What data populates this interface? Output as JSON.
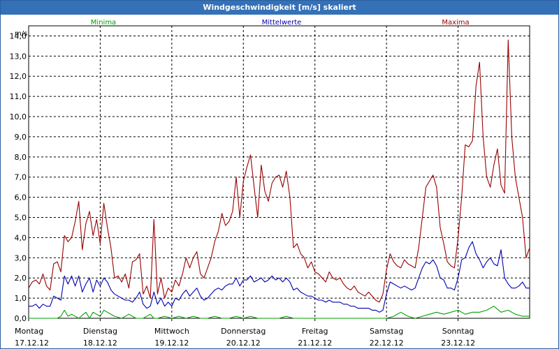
{
  "window": {
    "title": "Windgeschwindigkeit [m/s] skaliert"
  },
  "legend": {
    "minima": "Minima",
    "mittelwerte": "Mittelwerte",
    "maxima": "Maxima"
  },
  "colors": {
    "minima": "#00a000",
    "mittelwerte": "#0000b0",
    "maxima": "#990000",
    "titlebar": "#3471b7"
  },
  "chart_data": {
    "type": "line",
    "ylabel": "m/s",
    "ylim": [
      0,
      14.5
    ],
    "yticks": [
      "0,0",
      "1,0",
      "2,0",
      "3,0",
      "4,0",
      "5,0",
      "6,0",
      "7,0",
      "8,0",
      "9,0",
      "10,0",
      "11,0",
      "12,0",
      "13,0",
      "14,0"
    ],
    "xlim": [
      0,
      7
    ],
    "days": [
      {
        "weekday": "Montag",
        "date": "17.12.12"
      },
      {
        "weekday": "Dienstag",
        "date": "18.12.12"
      },
      {
        "weekday": "Mittwoch",
        "date": "19.12.12"
      },
      {
        "weekday": "Donnerstag",
        "date": "20.12.12"
      },
      {
        "weekday": "Freitag",
        "date": "21.12.12"
      },
      {
        "weekday": "Samstag",
        "date": "22.12.12"
      },
      {
        "weekday": "Sonntag",
        "date": "23.12.12"
      }
    ],
    "grid": true,
    "series": [
      {
        "name": "Maxima",
        "color": "#990000",
        "x": [
          0.0,
          0.05,
          0.1,
          0.15,
          0.2,
          0.25,
          0.3,
          0.35,
          0.4,
          0.45,
          0.5,
          0.55,
          0.6,
          0.65,
          0.7,
          0.75,
          0.8,
          0.85,
          0.9,
          0.95,
          1.0,
          1.05,
          1.1,
          1.15,
          1.2,
          1.25,
          1.3,
          1.35,
          1.4,
          1.45,
          1.5,
          1.55,
          1.6,
          1.65,
          1.7,
          1.75,
          1.8,
          1.85,
          1.9,
          1.95,
          2.0,
          2.05,
          2.1,
          2.15,
          2.2,
          2.25,
          2.3,
          2.35,
          2.4,
          2.45,
          2.5,
          2.55,
          2.6,
          2.65,
          2.7,
          2.75,
          2.8,
          2.85,
          2.9,
          2.95,
          3.0,
          3.05,
          3.1,
          3.15,
          3.2,
          3.25,
          3.3,
          3.35,
          3.4,
          3.45,
          3.5,
          3.55,
          3.6,
          3.65,
          3.7,
          3.75,
          3.8,
          3.85,
          3.9,
          3.95,
          4.0,
          4.05,
          4.1,
          4.15,
          4.2,
          4.25,
          4.3,
          4.35,
          4.4,
          4.45,
          4.5,
          4.55,
          4.6,
          4.65,
          4.7,
          4.75,
          4.8,
          4.85,
          4.9,
          4.95,
          5.0,
          5.05,
          5.1,
          5.15,
          5.2,
          5.25,
          5.3,
          5.35,
          5.4,
          5.45,
          5.5,
          5.55,
          5.6,
          5.65,
          5.7,
          5.75,
          5.8,
          5.85,
          5.9,
          5.95,
          6.0,
          6.05,
          6.1,
          6.15,
          6.2,
          6.25,
          6.3,
          6.35,
          6.4,
          6.45,
          6.5,
          6.55,
          6.6,
          6.65,
          6.7,
          6.75,
          6.8,
          6.85,
          6.9,
          6.95,
          7.0
        ],
        "y": [
          1.5,
          1.8,
          1.9,
          1.7,
          2.2,
          1.6,
          1.4,
          2.7,
          2.8,
          2.3,
          4.1,
          3.8,
          4.0,
          4.8,
          5.8,
          3.4,
          4.7,
          5.3,
          4.1,
          4.9,
          3.7,
          5.7,
          4.5,
          3.5,
          2.0,
          2.1,
          1.8,
          2.2,
          1.5,
          2.8,
          2.9,
          3.2,
          1.2,
          1.6,
          1.0,
          4.9,
          1.2,
          2.0,
          1.0,
          1.5,
          1.3,
          1.9,
          1.6,
          2.2,
          3.0,
          2.5,
          3.0,
          3.3,
          2.2,
          2.0,
          2.5,
          3.0,
          3.8,
          4.3,
          5.2,
          4.6,
          4.8,
          5.3,
          7.0,
          5.0,
          6.8,
          7.5,
          8.1,
          6.5,
          5.0,
          7.6,
          6.3,
          5.8,
          6.7,
          7.0,
          7.1,
          6.5,
          7.3,
          6.0,
          3.5,
          3.7,
          3.2,
          3.0,
          2.5,
          2.8,
          2.3,
          2.2,
          2.0,
          1.8,
          2.3,
          2.0,
          1.9,
          2.0,
          1.7,
          1.5,
          1.4,
          1.6,
          1.3,
          1.2,
          1.1,
          1.3,
          1.1,
          0.9,
          0.8,
          1.2,
          2.4,
          3.2,
          2.8,
          2.6,
          2.5,
          2.9,
          2.7,
          2.6,
          2.5,
          3.5,
          5.0,
          6.5,
          6.8,
          7.1,
          6.5,
          4.5,
          3.7,
          2.8,
          2.6,
          2.5,
          4.0,
          6.0,
          8.6,
          8.5,
          8.8,
          11.5,
          12.7,
          9.0,
          7.0,
          6.5,
          7.6,
          8.4,
          6.6,
          6.2,
          13.8,
          9.0,
          7.0,
          6.0,
          5.0,
          3.0,
          3.5
        ]
      },
      {
        "name": "Mittelwerte",
        "color": "#0000b0",
        "x": [
          0.0,
          0.05,
          0.1,
          0.15,
          0.2,
          0.25,
          0.3,
          0.35,
          0.4,
          0.45,
          0.5,
          0.55,
          0.6,
          0.65,
          0.7,
          0.75,
          0.8,
          0.85,
          0.9,
          0.95,
          1.0,
          1.05,
          1.1,
          1.15,
          1.2,
          1.25,
          1.3,
          1.35,
          1.4,
          1.45,
          1.5,
          1.55,
          1.6,
          1.65,
          1.7,
          1.75,
          1.8,
          1.85,
          1.9,
          1.95,
          2.0,
          2.05,
          2.1,
          2.15,
          2.2,
          2.25,
          2.3,
          2.35,
          2.4,
          2.45,
          2.5,
          2.55,
          2.6,
          2.65,
          2.7,
          2.75,
          2.8,
          2.85,
          2.9,
          2.95,
          3.0,
          3.05,
          3.1,
          3.15,
          3.2,
          3.25,
          3.3,
          3.35,
          3.4,
          3.45,
          3.5,
          3.55,
          3.6,
          3.65,
          3.7,
          3.75,
          3.8,
          3.85,
          3.9,
          3.95,
          4.0,
          4.05,
          4.1,
          4.15,
          4.2,
          4.25,
          4.3,
          4.35,
          4.4,
          4.45,
          4.5,
          4.55,
          4.6,
          4.65,
          4.7,
          4.75,
          4.8,
          4.85,
          4.9,
          4.95,
          5.0,
          5.05,
          5.1,
          5.15,
          5.2,
          5.25,
          5.3,
          5.35,
          5.4,
          5.45,
          5.5,
          5.55,
          5.6,
          5.65,
          5.7,
          5.75,
          5.8,
          5.85,
          5.9,
          5.95,
          6.0,
          6.05,
          6.1,
          6.15,
          6.2,
          6.25,
          6.3,
          6.35,
          6.4,
          6.45,
          6.5,
          6.55,
          6.6,
          6.65,
          6.7,
          6.75,
          6.8,
          6.85,
          6.9,
          6.95,
          7.0
        ],
        "y": [
          0.6,
          0.6,
          0.7,
          0.5,
          0.7,
          0.6,
          0.6,
          1.1,
          1.0,
          0.9,
          2.1,
          1.7,
          2.1,
          1.6,
          2.1,
          1.3,
          1.7,
          2.0,
          1.3,
          1.9,
          1.6,
          2.0,
          1.8,
          1.4,
          1.2,
          1.1,
          1.0,
          0.9,
          0.9,
          0.8,
          1.0,
          1.3,
          0.7,
          0.5,
          0.6,
          1.3,
          0.7,
          1.0,
          0.6,
          0.8,
          0.6,
          1.0,
          0.9,
          1.2,
          1.4,
          1.1,
          1.3,
          1.5,
          1.1,
          0.9,
          1.0,
          1.2,
          1.4,
          1.5,
          1.4,
          1.6,
          1.7,
          1.7,
          2.0,
          1.6,
          1.9,
          1.9,
          2.1,
          1.8,
          1.9,
          2.0,
          1.8,
          1.9,
          2.1,
          1.9,
          2.0,
          1.8,
          2.0,
          1.8,
          1.4,
          1.5,
          1.3,
          1.2,
          1.1,
          1.1,
          1.0,
          0.9,
          0.9,
          0.8,
          0.9,
          0.8,
          0.8,
          0.8,
          0.7,
          0.7,
          0.6,
          0.6,
          0.5,
          0.5,
          0.5,
          0.5,
          0.4,
          0.4,
          0.3,
          0.4,
          1.2,
          1.8,
          1.7,
          1.6,
          1.5,
          1.6,
          1.5,
          1.4,
          1.5,
          2.0,
          2.5,
          2.8,
          2.7,
          2.9,
          2.6,
          2.0,
          1.9,
          1.5,
          1.5,
          1.4,
          2.0,
          2.9,
          3.0,
          3.5,
          3.8,
          3.2,
          2.9,
          2.5,
          2.8,
          3.0,
          2.7,
          2.6,
          3.4,
          2.0,
          1.7,
          1.5,
          1.5,
          1.6,
          1.8,
          1.5,
          1.5
        ]
      },
      {
        "name": "Minima",
        "color": "#00a000",
        "x": [
          0.0,
          0.1,
          0.2,
          0.3,
          0.4,
          0.45,
          0.5,
          0.55,
          0.6,
          0.7,
          0.8,
          0.85,
          0.9,
          1.0,
          1.05,
          1.1,
          1.2,
          1.3,
          1.4,
          1.5,
          1.6,
          1.7,
          1.75,
          1.8,
          1.9,
          2.0,
          2.1,
          2.2,
          2.3,
          2.4,
          2.5,
          2.6,
          2.7,
          2.8,
          2.9,
          3.0,
          3.1,
          3.2,
          3.3,
          3.4,
          3.5,
          3.6,
          3.7,
          3.8,
          3.9,
          4.0,
          4.2,
          4.4,
          4.6,
          4.8,
          5.0,
          5.1,
          5.2,
          5.3,
          5.4,
          5.5,
          5.6,
          5.7,
          5.8,
          5.9,
          6.0,
          6.1,
          6.2,
          6.3,
          6.4,
          6.5,
          6.6,
          6.7,
          6.8,
          6.9,
          7.0
        ],
        "y": [
          0.0,
          0.0,
          0.0,
          0.0,
          0.0,
          0.1,
          0.4,
          0.1,
          0.2,
          0.0,
          0.3,
          0.0,
          0.3,
          0.1,
          0.4,
          0.3,
          0.1,
          0.0,
          0.2,
          0.0,
          0.0,
          0.2,
          0.0,
          0.0,
          0.1,
          0.0,
          0.1,
          0.0,
          0.1,
          0.0,
          0.0,
          0.1,
          0.0,
          0.0,
          0.1,
          0.0,
          0.1,
          0.0,
          0.0,
          0.0,
          0.0,
          0.1,
          0.0,
          0.0,
          0.0,
          0.0,
          0.0,
          0.0,
          0.0,
          0.0,
          0.0,
          0.1,
          0.3,
          0.1,
          0.0,
          0.1,
          0.2,
          0.3,
          0.2,
          0.3,
          0.4,
          0.2,
          0.3,
          0.3,
          0.4,
          0.6,
          0.3,
          0.4,
          0.2,
          0.1,
          0.1
        ]
      }
    ]
  }
}
